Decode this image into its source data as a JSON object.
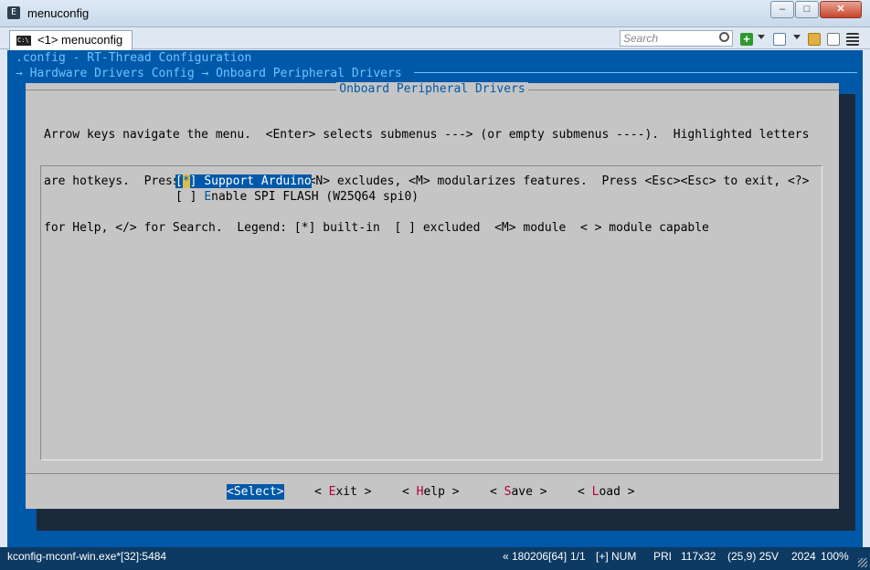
{
  "window": {
    "title": "menuconfig",
    "app_icon": "terminal-app-icon"
  },
  "tabs": [
    {
      "label": "<1> menuconfig"
    }
  ],
  "toolbar": {
    "search_placeholder": "Search"
  },
  "terminal": {
    "line1": ".config - RT-Thread Configuration",
    "line2": "→ Hardware Drivers Config → Onboard Peripheral Drivers",
    "dialog": {
      "title": "Onboard Peripheral Drivers",
      "help": [
        "Arrow keys navigate the menu.  <Enter> selects submenus ---> (or empty submenus ----).  Highlighted letters",
        "are hotkeys.  Pressing <Y> includes, <N> excludes, <M> modularizes features.  Press <Esc><Esc> to exit, <?>",
        "for Help, </> for Search.  Legend: [*] built-in  [ ] excluded  <M> module  < > module capable"
      ],
      "items": [
        {
          "bracket_open": "[",
          "mark": "*",
          "bracket_close": "]",
          "hotkey": "S",
          "rest": "upport Arduino",
          "selected": true
        },
        {
          "bracket_open": "[",
          "mark": " ",
          "bracket_close": "]",
          "hotkey": "E",
          "rest": "nable SPI FLASH (W25Q64 spi0)",
          "selected": false
        }
      ],
      "buttons": [
        {
          "label": "<Select>",
          "active": true
        },
        {
          "pre": "< ",
          "hotkey": "E",
          "rest": "xit",
          "post": " >"
        },
        {
          "pre": "< ",
          "hotkey": "H",
          "rest": "elp",
          "post": " >"
        },
        {
          "pre": "< ",
          "hotkey": "S",
          "rest": "ave",
          "post": " >"
        },
        {
          "pre": "< ",
          "hotkey": "L",
          "rest": "oad",
          "post": " >"
        }
      ]
    }
  },
  "statusbar": {
    "process": "kconfig-mconf-win.exe*[32]:5484",
    "build": "« 180206[64]",
    "pages": "1/1",
    "insert": "[+] NUM",
    "pri": "PRI",
    "size": "117x32",
    "cursor": "(25,9) 25V",
    "pid": "2024",
    "zoom": "100%"
  },
  "colors": {
    "terminal_bg": "#0058a8",
    "dialog_bg": "#c5c5c5",
    "hotkey_button": "#b2003a",
    "status_bg": "#0d3a63"
  }
}
